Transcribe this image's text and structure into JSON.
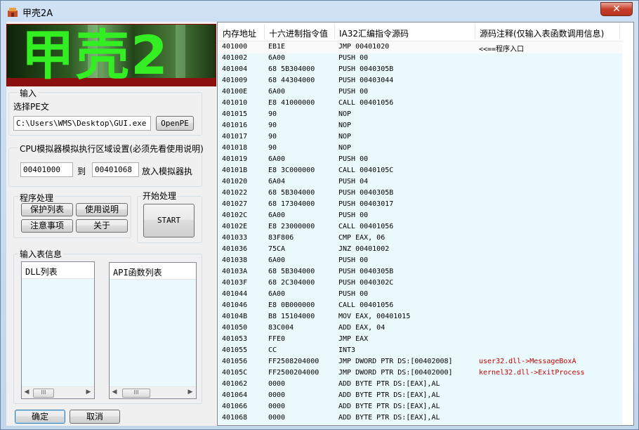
{
  "window": {
    "title": "甲壳2A",
    "close_glyph": "✕"
  },
  "banner": {
    "text": "甲壳2"
  },
  "input_group": {
    "legend": "输入",
    "select_label": "选择PE文",
    "pe_path": "C:\\Users\\WMS\\Desktop\\GUI.exe",
    "open_button": "OpenPE"
  },
  "cpu_group": {
    "legend": "CPU模拟器模拟执行区域设置(必须先看使用说明)",
    "start_addr": "00401000",
    "to_label": "到",
    "end_addr": "00401068",
    "suffix_label": "放入模拟器执"
  },
  "program_group": {
    "legend": "程序处理",
    "buttons": [
      "保护列表",
      "使用说明",
      "注意事项",
      "关于"
    ]
  },
  "start_group": {
    "legend": "开始处理",
    "button": "START"
  },
  "import_group": {
    "legend": "输入表信息",
    "dll_header": "DLL列表",
    "api_header": "API函数列表",
    "scroll_thumb": "III"
  },
  "footer": {
    "ok": "确定",
    "cancel": "取消"
  },
  "grid": {
    "headers": [
      "内存地址",
      "十六进制指令值",
      "IA32汇编指令源码",
      "源码注释(仅输入表函数调用信息)"
    ],
    "rows": [
      {
        "addr": "401000",
        "hex": "EB1E",
        "asm": "JMP 00401020",
        "note": "<<==程序入口"
      },
      {
        "addr": "401002",
        "hex": "6A00",
        "asm": "PUSH 00",
        "note": ""
      },
      {
        "addr": "401004",
        "hex": "68 5B304000",
        "asm": "PUSH 0040305B",
        "note": ""
      },
      {
        "addr": "401009",
        "hex": "68 44304000",
        "asm": "PUSH 00403044",
        "note": ""
      },
      {
        "addr": "40100E",
        "hex": "6A00",
        "asm": "PUSH 00",
        "note": ""
      },
      {
        "addr": "401010",
        "hex": "E8 41000000",
        "asm": "CALL 00401056",
        "note": ""
      },
      {
        "addr": "401015",
        "hex": "90",
        "asm": "NOP",
        "note": ""
      },
      {
        "addr": "401016",
        "hex": "90",
        "asm": "NOP",
        "note": ""
      },
      {
        "addr": "401017",
        "hex": "90",
        "asm": "NOP",
        "note": ""
      },
      {
        "addr": "401018",
        "hex": "90",
        "asm": "NOP",
        "note": ""
      },
      {
        "addr": "401019",
        "hex": "6A00",
        "asm": "PUSH 00",
        "note": ""
      },
      {
        "addr": "40101B",
        "hex": "E8 3C000000",
        "asm": "CALL 0040105C",
        "note": ""
      },
      {
        "addr": "401020",
        "hex": "6A04",
        "asm": "PUSH 04",
        "note": ""
      },
      {
        "addr": "401022",
        "hex": "68 5B304000",
        "asm": "PUSH 0040305B",
        "note": ""
      },
      {
        "addr": "401027",
        "hex": "68 17304000",
        "asm": "PUSH 00403017",
        "note": ""
      },
      {
        "addr": "40102C",
        "hex": "6A00",
        "asm": "PUSH 00",
        "note": ""
      },
      {
        "addr": "40102E",
        "hex": "E8 23000000",
        "asm": "CALL 00401056",
        "note": ""
      },
      {
        "addr": "401033",
        "hex": "83F806",
        "asm": "CMP EAX, 06",
        "note": ""
      },
      {
        "addr": "401036",
        "hex": "75CA",
        "asm": "JNZ 00401002",
        "note": ""
      },
      {
        "addr": "401038",
        "hex": "6A00",
        "asm": "PUSH 00",
        "note": ""
      },
      {
        "addr": "40103A",
        "hex": "68 5B304000",
        "asm": "PUSH 0040305B",
        "note": ""
      },
      {
        "addr": "40103F",
        "hex": "68 2C304000",
        "asm": "PUSH 0040302C",
        "note": ""
      },
      {
        "addr": "401044",
        "hex": "6A00",
        "asm": "PUSH 00",
        "note": ""
      },
      {
        "addr": "401046",
        "hex": "E8 0B000000",
        "asm": "CALL 00401056",
        "note": ""
      },
      {
        "addr": "40104B",
        "hex": "B8 15104000",
        "asm": "MOV EAX, 00401015",
        "note": ""
      },
      {
        "addr": "401050",
        "hex": "83C004",
        "asm": "ADD EAX, 04",
        "note": ""
      },
      {
        "addr": "401053",
        "hex": "FFE0",
        "asm": "JMP EAX",
        "note": ""
      },
      {
        "addr": "401055",
        "hex": "CC",
        "asm": "INT3",
        "note": ""
      },
      {
        "addr": "401056",
        "hex": "FF2508204000",
        "asm": "JMP DWORD PTR DS:[00402008]",
        "note": "user32.dll->MessageBoxA",
        "note_red": true
      },
      {
        "addr": "40105C",
        "hex": "FF2500204000",
        "asm": "JMP DWORD PTR DS:[00402000]",
        "note": "kernel32.dll->ExitProcess",
        "note_red": true
      },
      {
        "addr": "401062",
        "hex": "0000",
        "asm": "ADD BYTE PTR DS:[EAX],AL",
        "note": ""
      },
      {
        "addr": "401064",
        "hex": "0000",
        "asm": "ADD BYTE PTR DS:[EAX],AL",
        "note": ""
      },
      {
        "addr": "401066",
        "hex": "0000",
        "asm": "ADD BYTE PTR DS:[EAX],AL",
        "note": ""
      },
      {
        "addr": "401068",
        "hex": "0000",
        "asm": "ADD BYTE PTR DS:[EAX],AL",
        "note": ""
      }
    ]
  }
}
